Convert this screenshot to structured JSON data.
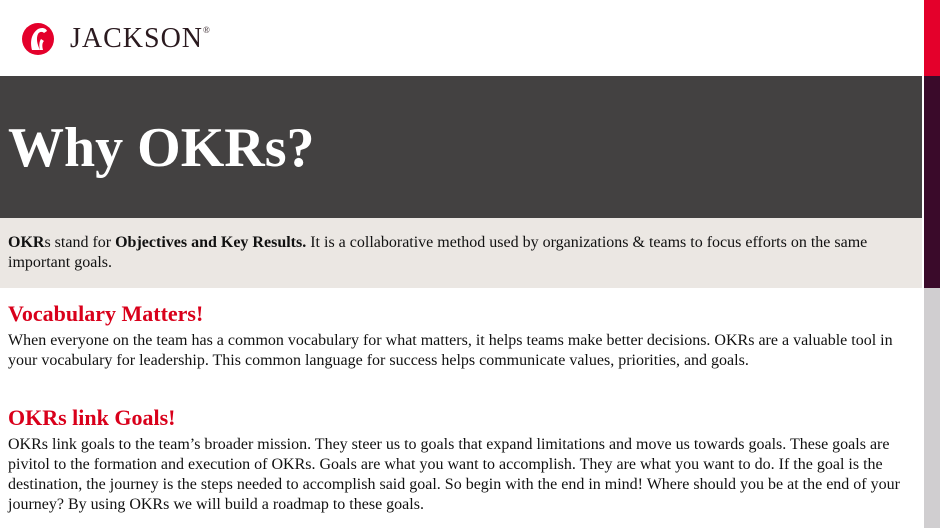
{
  "brand": {
    "name": "JACKSON",
    "mark": "®",
    "color": "#e4002b"
  },
  "title": "Why OKRs?",
  "intro": {
    "term": "OKR",
    "rest1": "s stand for ",
    "bold": "Objectives and Key Results.",
    "rest2": " It is a collaborative method used by organizations & teams to focus efforts on the same important goals."
  },
  "sections": [
    {
      "heading": "Vocabulary Matters!",
      "body": "When everyone on the team has a common vocabulary for what matters, it helps teams make better decisions. OKRs are a valuable tool in your vocabulary for leadership. This common language for success helps communicate values, priorities, and goals."
    },
    {
      "heading": "OKRs link Goals!",
      "body": "OKRs link goals to the team’s broader mission. They steer us to goals that expand limitations and move us towards goals. These goals are pivitol to the formation and execution of OKRs. Goals are what you want to accomplish. They are what you want to do. If the goal is the destination, the journey is the steps needed to accomplish said goal. So begin with the end in mind! Where should you be at the end of your journey? By using OKRs we will build a roadmap to these goals."
    }
  ],
  "colors": {
    "heading_red": "#d9001b",
    "title_band": "#434141",
    "intro_band": "#ebe7e3",
    "side_red": "#e4002b",
    "side_plum": "#3a0a2a",
    "side_grey": "#d0ced0"
  }
}
